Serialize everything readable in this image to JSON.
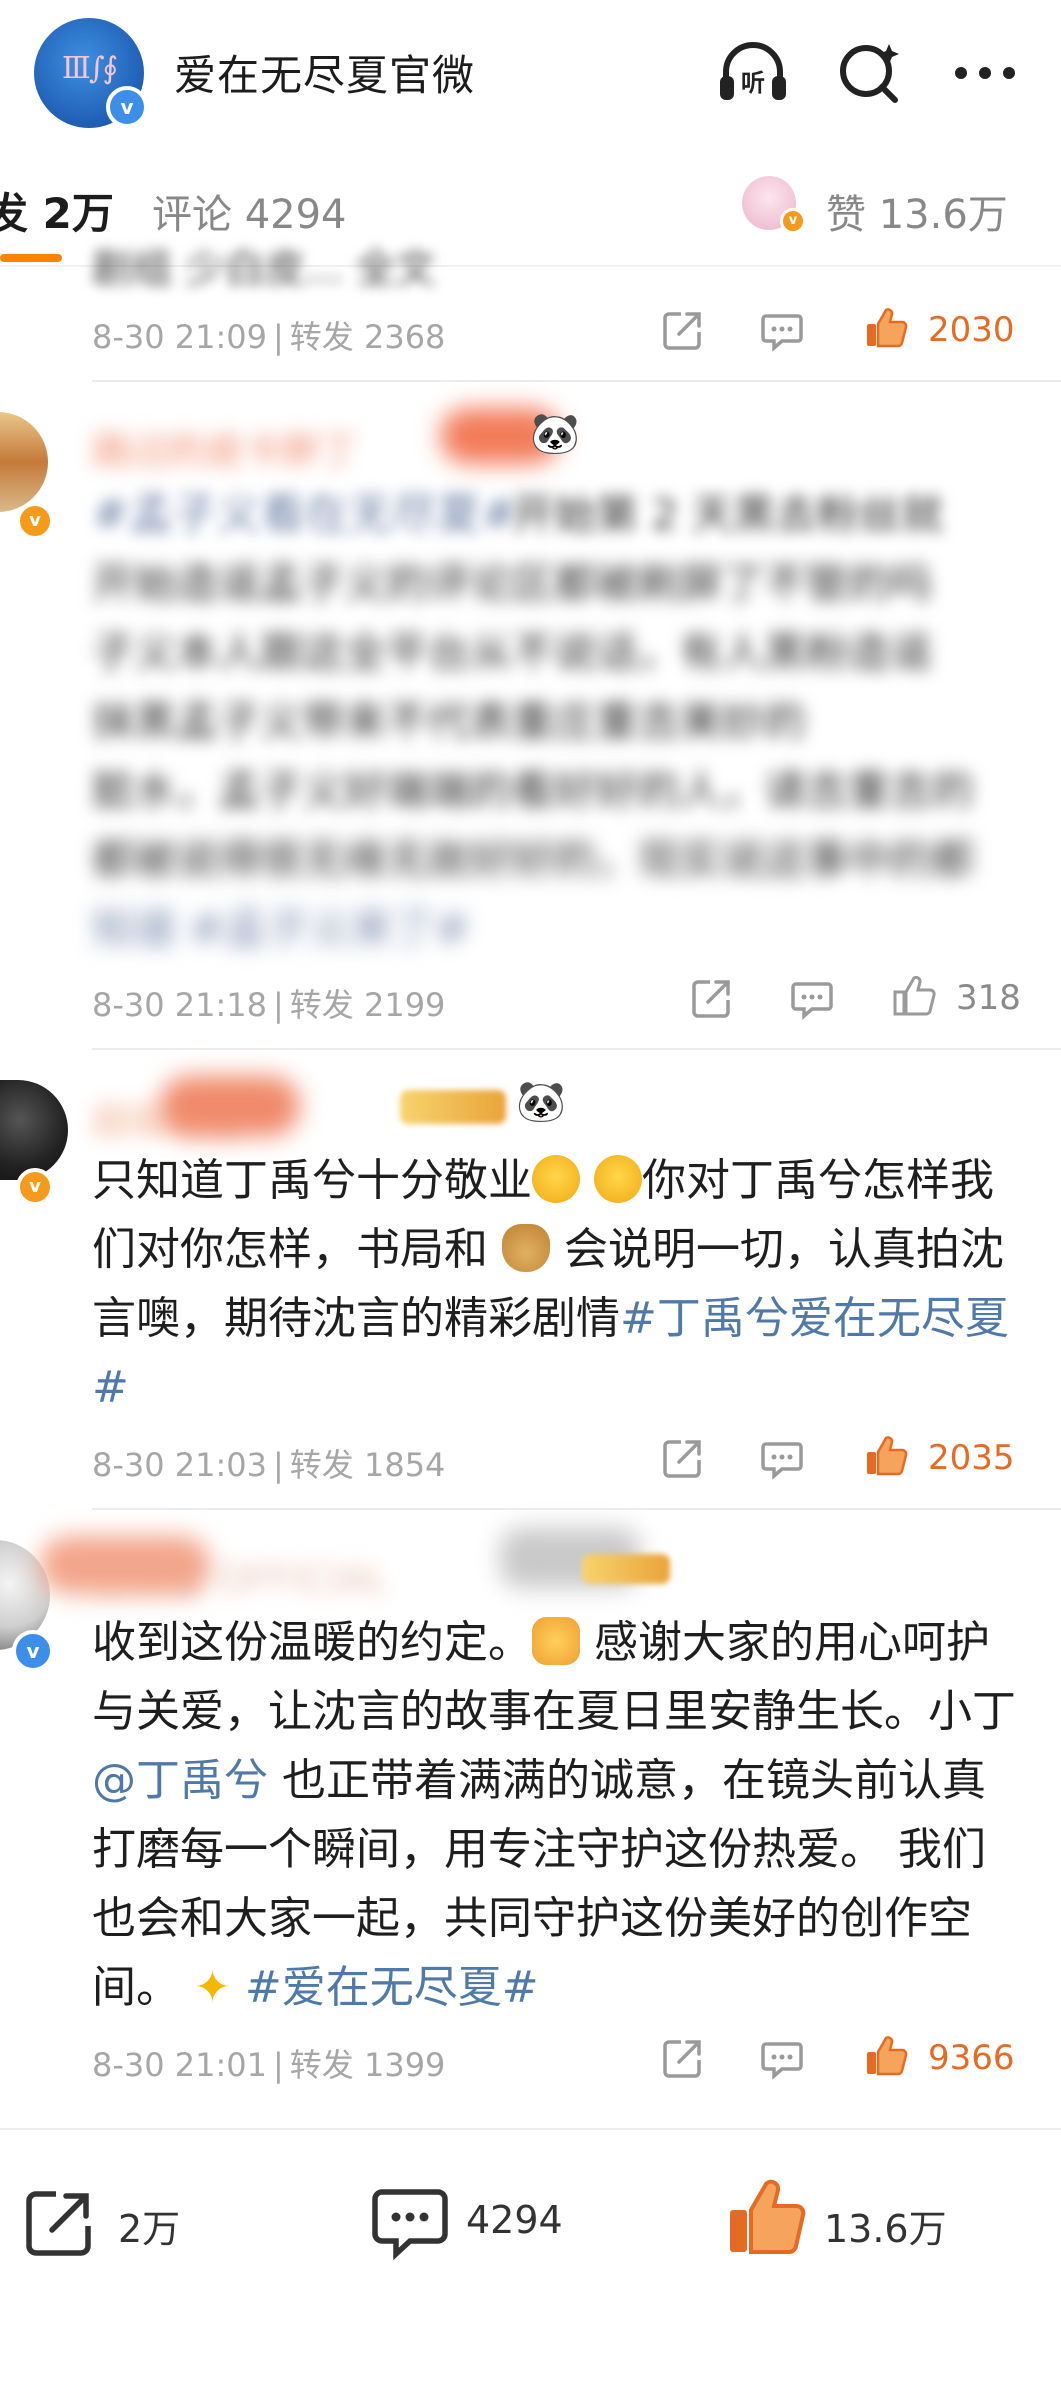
{
  "header": {
    "title": "爱在无尽夏官微",
    "listen_icon": "headphones-listen-icon",
    "search_icon": "search-icon",
    "more_icon": "more-icon"
  },
  "tabs": {
    "repost_label": "发 2万",
    "comment_label": "评论 4294",
    "like_label": "赞 13.6万"
  },
  "posts": [
    {
      "top_text": "剧组 少白皮... 全文",
      "time": "8-30 21:09",
      "repost": "转发 2368",
      "likes": "2030",
      "liked": true
    },
    {
      "name": "路过的皮卡胖丁",
      "hashtag_start": "#孟子义看在无尽夏#",
      "visible_fragments": [
        "开始第 2 天黑去粉丝就",
        "开",
        "孟",
        "子义",
        "不",
        "妙的",
        "脏",
        "的"
      ],
      "blurred_lines": [
        "开始第2天黑去粉丝就开始造谣",
        "开始造谣孟子义的评论区都被刷屏了不管的吗",
        "子义本人跟这全平台从不说话，有人黑粉造谣",
        "抹黑孟子义带来不代表重庄重吉美妙的",
        "脏水，孟子义好端端的看好好的人，请吉重吉的",
        "都被说得很无缘无故好好的，现实说这事中的都",
        "知道 #孟子义来了#"
      ],
      "time": "8-30 21:18",
      "repost": "转发 2199",
      "likes": "318",
      "liked": false
    },
    {
      "name": "超级粉丝",
      "text_before": "只知道丁禹兮十分敬业",
      "text_after_emoji": "你对丁禹兮怎样我们对你怎样，书局和",
      "text_after_bag": "会说明一切，认真拍沈言噢，期待沈言的精彩剧情",
      "hashtag": "#丁禹兮爱在无尽夏 #",
      "time": "8-30 21:03",
      "repost": "转发 1854",
      "likes": "2035",
      "liked": true
    },
    {
      "name": "工作室 OFFICIAL",
      "text_1": "收到这份温暖的约定。",
      "text_2": "感谢大家的用心呵护与关爱，让沈言的故事在夏日里安静生长。小丁",
      "mention": "@丁禹兮",
      "text_3": "也正带着满满的诚意，在镜头前认真打磨每一个瞬间，用专注守护这份热爱。 我们也会和大家一起，共同守护这份美好的创作空间。",
      "hashtag": "#爱在无尽夏#",
      "time": "8-30 21:01",
      "repost": "转发 1399",
      "likes": "9366",
      "liked": true
    }
  ],
  "bottom": {
    "repost_count": "2万",
    "comment_count": "4294",
    "like_count": "13.6万"
  },
  "colors": {
    "accent_orange": "#ff8200",
    "like_orange": "#e66b22",
    "link_blue": "#4e79a8",
    "meta_gray": "#a6a6a6"
  }
}
